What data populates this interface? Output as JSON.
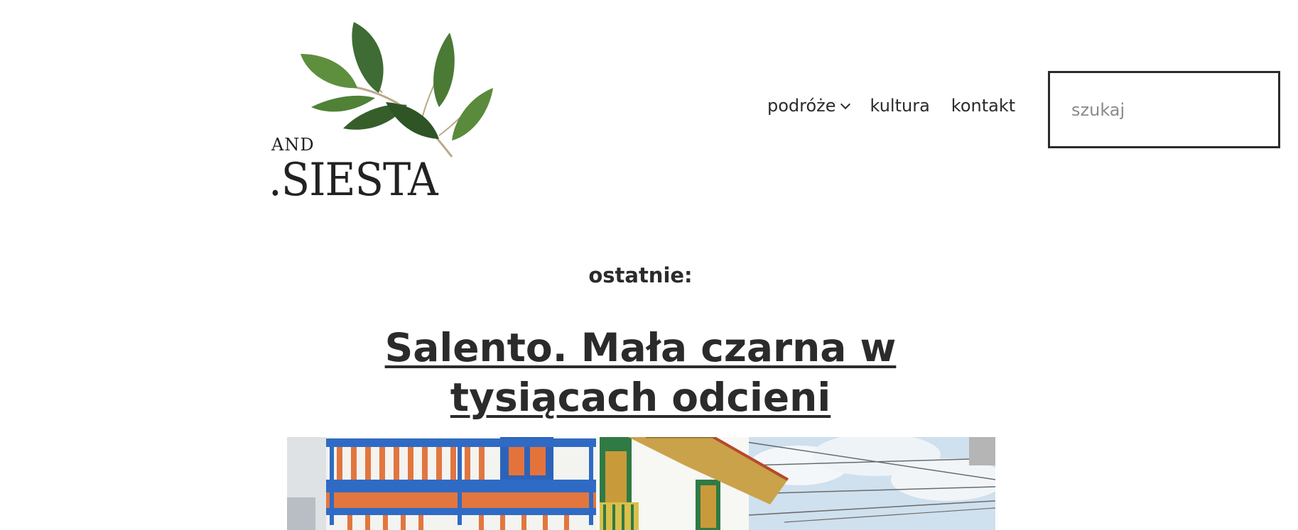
{
  "header": {
    "logo": {
      "small_text": "AND",
      "large_text": ".SIESTA"
    },
    "nav": {
      "items": [
        {
          "label": "podróże",
          "has_dropdown": true
        },
        {
          "label": "kultura",
          "has_dropdown": false
        },
        {
          "label": "kontakt",
          "has_dropdown": false
        }
      ]
    },
    "search": {
      "placeholder": "szukaj",
      "value": ""
    }
  },
  "main": {
    "section_label": "ostatnie:",
    "latest_post": {
      "title_line1": "Salento. Mała czarna w",
      "title_line2": "tysiącach odcieni"
    }
  },
  "colors": {
    "text": "#2b2b2b",
    "background": "#ffffff",
    "leaf_dark": "#3f6b34",
    "leaf_light": "#5e8f3e"
  }
}
